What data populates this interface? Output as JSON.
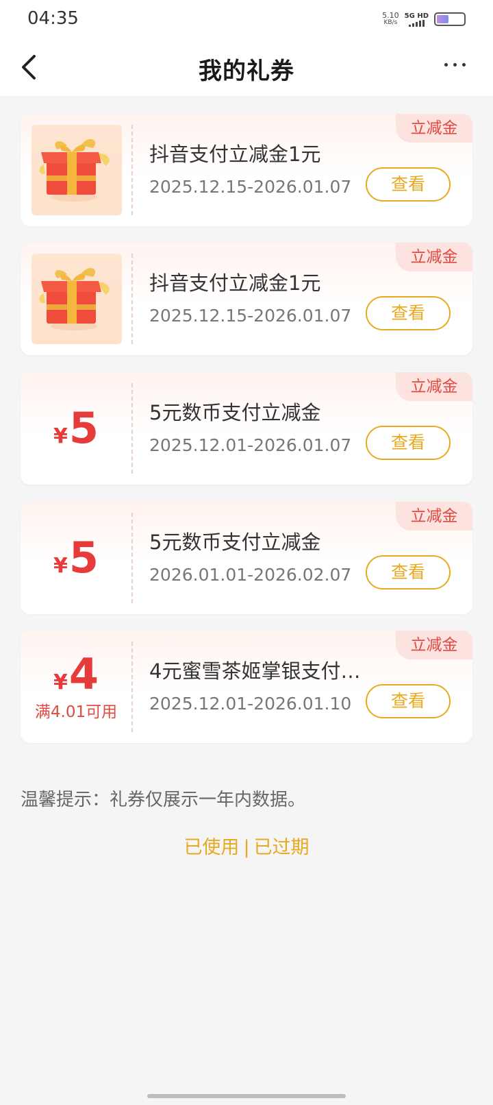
{
  "status_bar": {
    "time": "04:35",
    "net_speed": "5.10",
    "net_unit": "KB/s",
    "network_label": "5G HD",
    "battery_level": 0.45
  },
  "header": {
    "back_icon": "chevron-left-icon",
    "title": "我的礼券",
    "more_icon": "more-dots-icon"
  },
  "coupons": [
    {
      "tag": "立减金",
      "visual": "gift-box",
      "title": "抖音支付立减金1元",
      "date": "2025.12.15-2026.01.07",
      "action": "查看"
    },
    {
      "tag": "立减金",
      "visual": "gift-box",
      "title": "抖音支付立减金1元",
      "date": "2025.12.15-2026.01.07",
      "action": "查看"
    },
    {
      "tag": "立减金",
      "visual": "amount",
      "currency": "¥",
      "amount": "5",
      "title": "5元数币支付立减金",
      "date": "2025.12.01-2026.01.07",
      "action": "查看"
    },
    {
      "tag": "立减金",
      "visual": "amount",
      "currency": "¥",
      "amount": "5",
      "title": "5元数币支付立减金",
      "date": "2026.01.01-2026.02.07",
      "action": "查看"
    },
    {
      "tag": "立减金",
      "visual": "amount",
      "currency": "¥",
      "amount": "4",
      "condition": "满4.01可用",
      "title": "4元蜜雪茶姬掌银支付…",
      "date": "2025.12.01-2026.01.10",
      "action": "查看"
    }
  ],
  "tip": "温馨提示：礼券仅展示一年内数据。",
  "footer_links": {
    "used": "已使用",
    "separator": "|",
    "expired": "已过期"
  },
  "colors": {
    "accent": "#e8a91e",
    "price_red": "#e53b3b",
    "tag_bg": "#fde3e0"
  }
}
